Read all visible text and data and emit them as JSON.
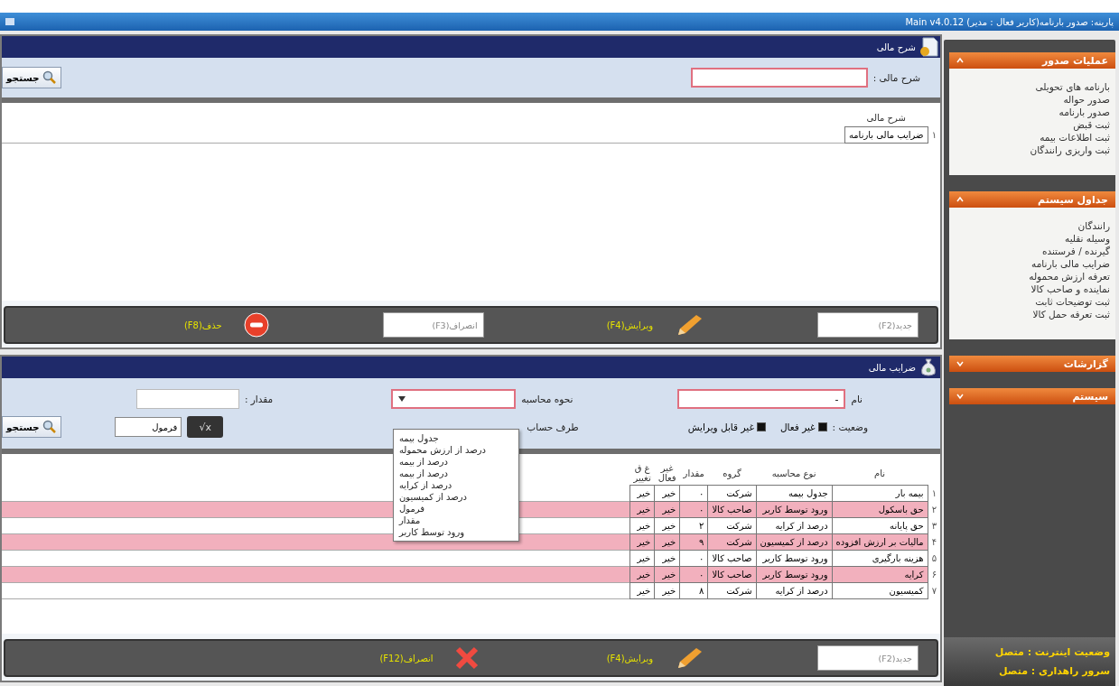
{
  "window": {
    "title": "پارینه: صدور بارنامه(کاربر فعال : مدیر) Main v4.0.12"
  },
  "sidebar": {
    "sections": [
      {
        "title": "عملیات صدور",
        "expanded": true,
        "items": [
          "بارنامه های تحویلی",
          "صدور حواله",
          "صدور بارنامه",
          "ثبت قبض",
          "ثبت اطلاعات بیمه",
          "ثبت واریزی رانندگان"
        ]
      },
      {
        "title": "جداول سیستم",
        "expanded": true,
        "items": [
          "رانندگان",
          "وسیله نقلیه",
          "گیرنده / فرستنده",
          "ضرایب مالی بارنامه",
          "تعرفه ارزش محموله",
          "نماینده و صاحب کالا",
          "ثبت توضیحات ثابت",
          "ثبت تعرفه حمل کالا"
        ]
      },
      {
        "title": "گزارشات",
        "expanded": false
      },
      {
        "title": "سیستم",
        "expanded": false
      }
    ],
    "status": [
      "وضعیت اینترنت : متصل",
      "سرور راهداری : متصل"
    ]
  },
  "top_panel": {
    "title": "شرح مالی",
    "filter_label": "شرح مالی :",
    "search_button": "جستجو",
    "table": {
      "columns": [
        "شرح مالی"
      ],
      "rows": [
        {
          "number": "۱",
          "cells": [
            "ضرایب مالی بارنامه"
          ]
        }
      ]
    },
    "toolbar": [
      {
        "kind": "box",
        "label": "جدید(F2)"
      },
      {
        "kind": "edit",
        "label": "ویرایش(F4)"
      },
      {
        "kind": "box",
        "label": "انصراف(F3)"
      },
      {
        "kind": "delete",
        "label": "حذف(F8)"
      }
    ]
  },
  "bottom_panel": {
    "title": "ضرایب مالی",
    "name_label": "نام",
    "name_value": "-",
    "method_label": "نحوه محاسبه",
    "amount_label": "مقدار :",
    "status_label": "وضعیت :",
    "checkboxes": [
      {
        "label": "غیر فعال",
        "checked": true
      },
      {
        "label": "غیر قابل ویرایش",
        "checked": true
      }
    ],
    "account_label": "طرف حساب",
    "formula_field": "فرمول",
    "formula_button": "√x",
    "search_button": "جستجو",
    "method_options": [
      "جدول بیمه",
      "درصد از ارزش محموله",
      "درصد از بیمه",
      "درصد از بیمه",
      "درصد از کرایه",
      "درصد از کمیسیون",
      "فرمول",
      "مقدار",
      "ورود توسط کاربر"
    ],
    "table": {
      "columns": [
        "نام",
        "نوع محاسبه",
        "گروه",
        "مقدار",
        "غیر فعال",
        "غ ق تغییر"
      ],
      "rows": [
        {
          "number": "۱",
          "highlighted": false,
          "cells": [
            "بیمه بار",
            "جدول بیمه",
            "شرکت",
            "۰",
            "خیر",
            "خیر"
          ]
        },
        {
          "number": "۲",
          "highlighted": true,
          "cells": [
            "حق باسکول",
            "ورود توسط کاربر",
            "صاحب کالا",
            "۰",
            "خیر",
            "خیر"
          ]
        },
        {
          "number": "۳",
          "highlighted": false,
          "cells": [
            "حق پایانه",
            "درصد از کرایه",
            "شرکت",
            "۲",
            "خیر",
            "خیر"
          ]
        },
        {
          "number": "۴",
          "highlighted": true,
          "cells": [
            "مالیات بر ارزش افزوده",
            "درصد از کمیسیون",
            "شرکت",
            "۹",
            "خیر",
            "خیر"
          ]
        },
        {
          "number": "۵",
          "highlighted": false,
          "cells": [
            "هزینه بارگیری",
            "ورود توسط کاربر",
            "صاحب کالا",
            "۰",
            "خیر",
            "خیر"
          ]
        },
        {
          "number": "۶",
          "highlighted": true,
          "cells": [
            "کرایه",
            "ورود توسط کاربر",
            "صاحب کالا",
            "۰",
            "خیر",
            "خیر"
          ]
        },
        {
          "number": "۷",
          "highlighted": false,
          "cells": [
            "کمیسیون",
            "درصد از کرایه",
            "شرکت",
            "۸",
            "خیر",
            "خیر"
          ]
        }
      ]
    },
    "toolbar": [
      {
        "kind": "box",
        "label": "جدید(F2)"
      },
      {
        "kind": "edit",
        "label": "ویرایش(F4)"
      },
      {
        "kind": "cancel",
        "label": "انصراف(F12)"
      }
    ]
  }
}
